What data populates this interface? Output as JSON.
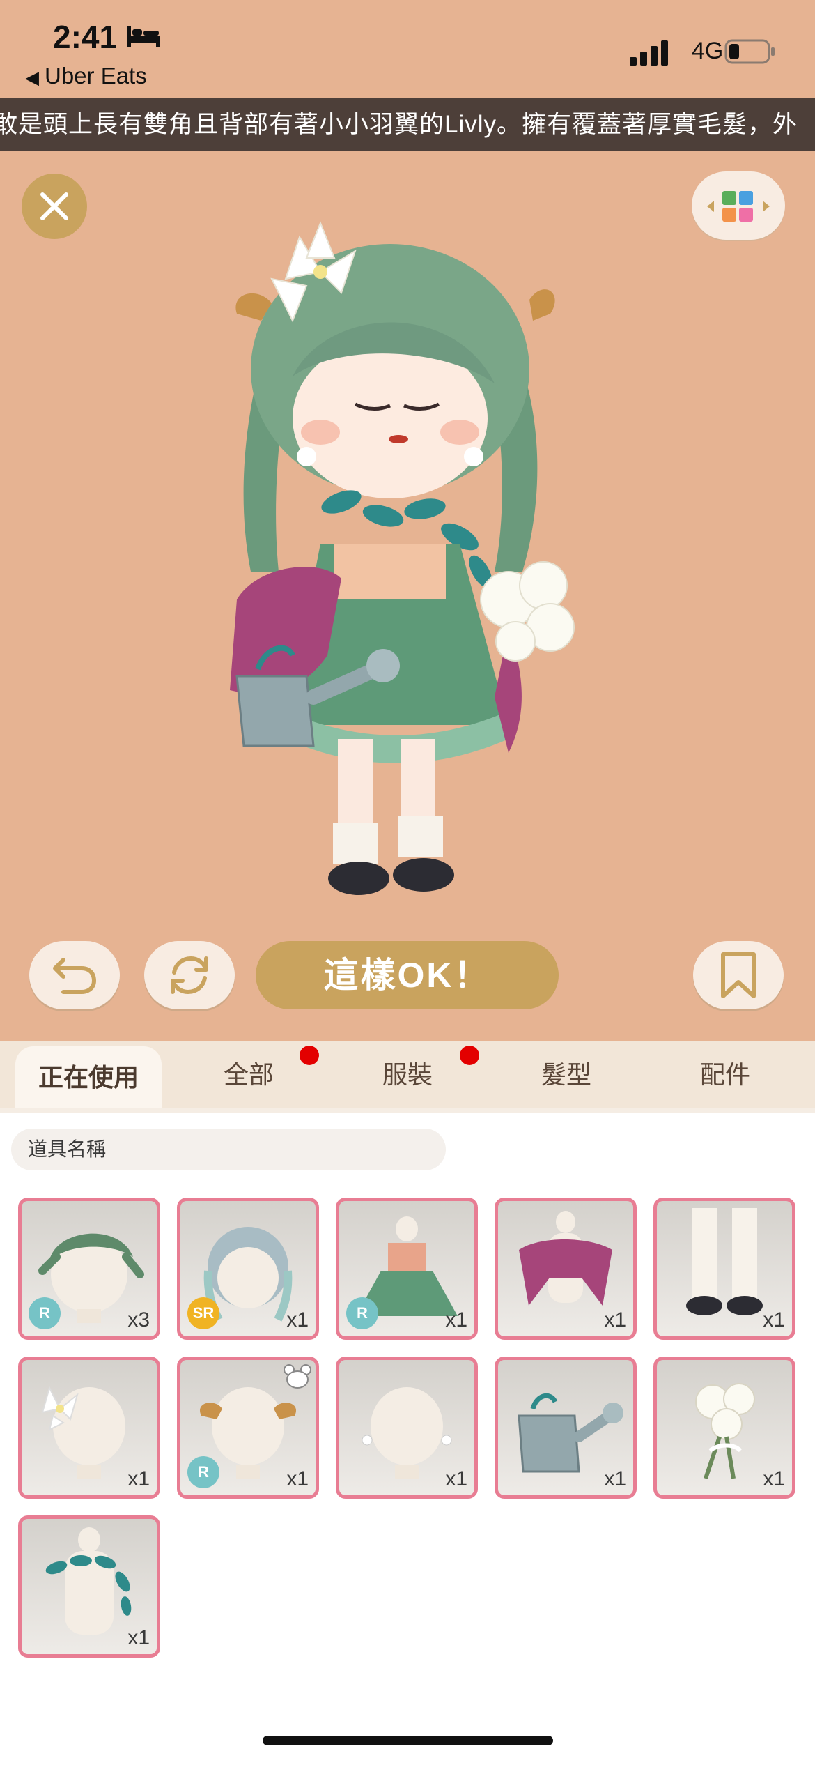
{
  "status_bar": {
    "time": "2:41",
    "back_app": "Uber Eats",
    "network": "4G",
    "icons": [
      "bed-icon",
      "signal-icon",
      "battery-icon"
    ]
  },
  "marquee_text": "敢是頭上長有雙角且背部有著小小羽翼的Livly。擁有覆蓋著厚實毛髮，外",
  "buttons": {
    "ok_label": "這樣OK！",
    "icons": [
      "close-icon",
      "palette-icon",
      "undo-icon",
      "refresh-icon",
      "bookmark-icon"
    ]
  },
  "tabs": [
    {
      "label": "正在使用",
      "active": true,
      "badge": false
    },
    {
      "label": "全部",
      "active": false,
      "badge": true
    },
    {
      "label": "服裝",
      "active": false,
      "badge": true
    },
    {
      "label": "髮型",
      "active": false,
      "badge": false
    },
    {
      "label": "配件",
      "active": false,
      "badge": false
    }
  ],
  "search": {
    "placeholder": "道具名稱"
  },
  "items": [
    {
      "name": "leaf-hair-cap",
      "rarity": "R",
      "count": "x3"
    },
    {
      "name": "braided-hair",
      "rarity": "SR",
      "count": "x1"
    },
    {
      "name": "green-dress",
      "rarity": "R",
      "count": "x1"
    },
    {
      "name": "pink-wrap",
      "rarity": "",
      "count": "x1"
    },
    {
      "name": "socks-shoes",
      "rarity": "",
      "count": "x1"
    },
    {
      "name": "lily-hairpin",
      "rarity": "",
      "count": "x1"
    },
    {
      "name": "horn-accessory",
      "rarity": "R",
      "count": "x1"
    },
    {
      "name": "pearl-earrings",
      "rarity": "",
      "count": "x1"
    },
    {
      "name": "watering-can",
      "rarity": "",
      "count": "x1"
    },
    {
      "name": "rose-bouquet",
      "rarity": "",
      "count": "x1"
    },
    {
      "name": "ivy-necklace",
      "rarity": "",
      "count": "x1"
    }
  ],
  "colors": {
    "background": "#e6b392",
    "accent_gold": "#c9a35e",
    "item_border": "#e87d93",
    "badge_red": "#e30000",
    "rarity_r": "#76c3c6",
    "rarity_sr": "#f0b323"
  }
}
